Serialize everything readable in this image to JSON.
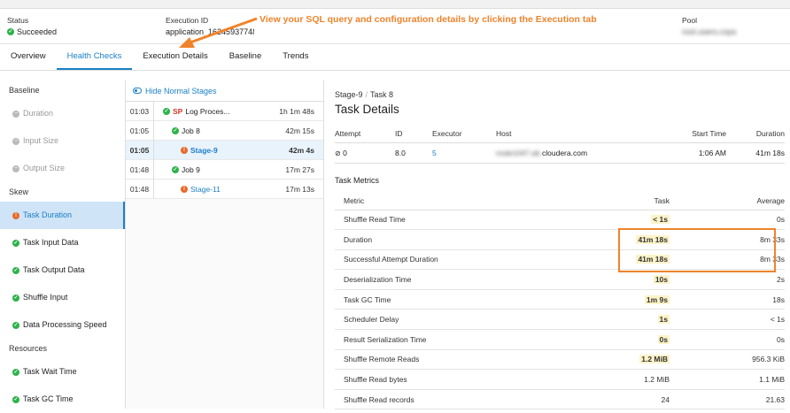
{
  "summary": {
    "status_label": "Status",
    "status_value": "Succeeded",
    "execution_label": "Execution ID",
    "execution_value": "application_16245937748",
    "pool_label": "Pool",
    "pool_value": "root.users.cops"
  },
  "annotation": "View your SQL query and configuration details by clicking the Execution tab",
  "tabs": [
    "Overview",
    "Health Checks",
    "Execution Details",
    "Baseline",
    "Trends"
  ],
  "sidebar": {
    "baseline_header": "Baseline",
    "baseline_items": [
      "Duration",
      "Input Size",
      "Output Size"
    ],
    "skew_header": "Skew",
    "skew_items": [
      "Task Duration",
      "Task Input Data",
      "Task Output Data",
      "Shuffle Input",
      "Data Processing Speed"
    ],
    "resources_header": "Resources",
    "resources_items": [
      "Task Wait Time",
      "Task GC Time"
    ]
  },
  "stages": {
    "hide_label": "Hide Normal Stages",
    "rows": [
      {
        "time": "01:03",
        "prefix": "SP",
        "name": "Log Proces...",
        "duration": "1h 1m 48s"
      },
      {
        "time": "01:05",
        "prefix": "",
        "name": "Job 8",
        "duration": "42m 15s"
      },
      {
        "time": "01:05",
        "prefix": "",
        "name": "Stage-9",
        "duration": "42m 4s"
      },
      {
        "time": "01:48",
        "prefix": "",
        "name": "Job 9",
        "duration": "17m 27s"
      },
      {
        "time": "01:48",
        "prefix": "",
        "name": "Stage-11",
        "duration": "17m 13s"
      }
    ]
  },
  "details": {
    "crumb_stage": "Stage-9",
    "crumb_task": "Task 8",
    "title": "Task Details",
    "attempt_headers": [
      "Attempt",
      "ID",
      "Executor",
      "Host",
      "Start Time",
      "Duration"
    ],
    "attempt_row": {
      "attempt": "0",
      "id": "8.0",
      "executor": "5",
      "host_hidden": "node1047.ab.",
      "host_visible": "cloudera.com",
      "start": "1:06 AM",
      "duration": "41m 18s"
    },
    "metrics_title": "Task Metrics",
    "metric_headers": [
      "Metric",
      "Task",
      "Average"
    ],
    "metrics": [
      {
        "metric": "Shuffle Read Time",
        "task": "< 1s",
        "average": "0s"
      },
      {
        "metric": "Duration",
        "task": "41m 18s",
        "average": "8m 33s"
      },
      {
        "metric": "Successful Attempt Duration",
        "task": "41m 18s",
        "average": "8m 33s"
      },
      {
        "metric": "Deserialization Time",
        "task": "10s",
        "average": "2s"
      },
      {
        "metric": "Task GC Time",
        "task": "1m 9s",
        "average": "18s"
      },
      {
        "metric": "Scheduler Delay",
        "task": "1s",
        "average": "< 1s"
      },
      {
        "metric": "Result Serialization Time",
        "task": "0s",
        "average": "0s"
      },
      {
        "metric": "Shuffle Remote Reads",
        "task": "1.2 MiB",
        "average": "956.3 KiB"
      },
      {
        "metric": "Shuffle Read bytes",
        "task": "1.2 MiB",
        "average": "1.1 MiB"
      },
      {
        "metric": "Shuffle Read records",
        "task": "24",
        "average": "21.63"
      }
    ]
  },
  "colors": {
    "accent": "#1b7fc6",
    "success": "#2db34a",
    "warning": "#e8692a",
    "annotation": "#f0832a"
  }
}
